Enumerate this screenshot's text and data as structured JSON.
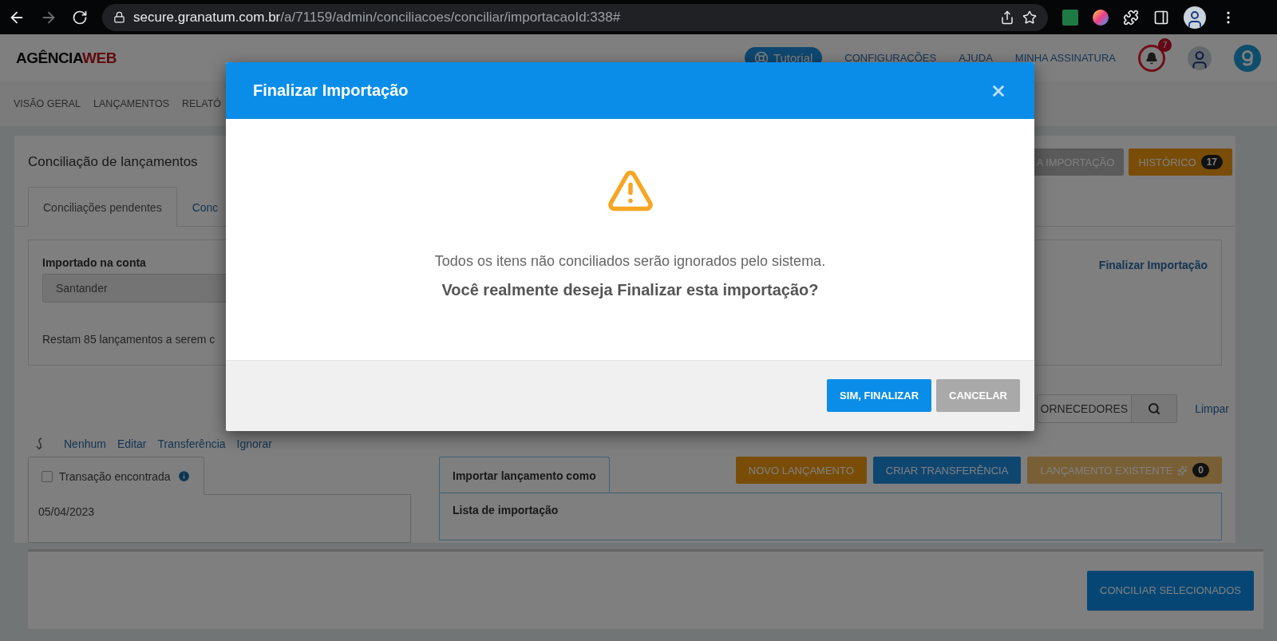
{
  "browser": {
    "url_host": "secure.granatum.com.br",
    "url_path": "/a/71159/admin/conciliacoes/conciliar/importacaoId:338#",
    "forward_disabled": true
  },
  "header": {
    "logo_main": "AGÊNCIA",
    "logo_accent": "WEB",
    "tutorial": "Tutorial",
    "links": [
      "CONFIGURAÇÕES",
      "AJUDA",
      "MINHA ASSINATURA"
    ],
    "notifications": "7"
  },
  "nav": [
    "VISÃO GERAL",
    "LANÇAMENTOS",
    "RELATÓ"
  ],
  "page": {
    "title": "Conciliação de lançamentos",
    "header_buttons": [
      {
        "label": "A IMPORTAÇÃO",
        "kind": "grey"
      },
      {
        "label": "HISTÓRICO",
        "kind": "orange",
        "count": "17"
      }
    ],
    "tabs": [
      {
        "label": "Conciliações pendentes",
        "selected": true
      },
      {
        "label": "Conc",
        "selected": false
      }
    ],
    "account": {
      "label": "Importado na conta",
      "value": "Santander",
      "remaining": "Restam 85 lançamentos a serem c",
      "finalize_link": "Finalizar Importação"
    },
    "filter": {
      "value": "ORNECEDORES",
      "clear": "Limpar"
    },
    "bulk_actions": [
      "Nenhum",
      "Editar",
      "Transferência",
      "Ignorar"
    ],
    "transaction": {
      "checked": false,
      "label": "Transação encontrada",
      "date": "05/04/2023"
    },
    "import": {
      "tab": "Importar lançamento como",
      "list_label": "Lista de importação",
      "buttons": [
        {
          "label": "NOVO LANÇAMENTO",
          "kind": "orange"
        },
        {
          "label": "CRIAR TRANSFERÊNCIA",
          "kind": "blue"
        },
        {
          "label": "LANÇAMENTO EXISTENTE",
          "kind": "pale",
          "count": "0"
        }
      ]
    },
    "footer_button": "CONCILIAR SELECIONADOS"
  },
  "modal": {
    "title": "Finalizar Importação",
    "message": "Todos os itens não conciliados serão ignorados pelo sistema.",
    "question": "Você realmente deseja Finalizar esta importação?",
    "buttons": [
      {
        "label": "SIM, FINALIZAR",
        "kind": "primary"
      },
      {
        "label": "CANCELAR",
        "kind": "secondary"
      }
    ]
  }
}
